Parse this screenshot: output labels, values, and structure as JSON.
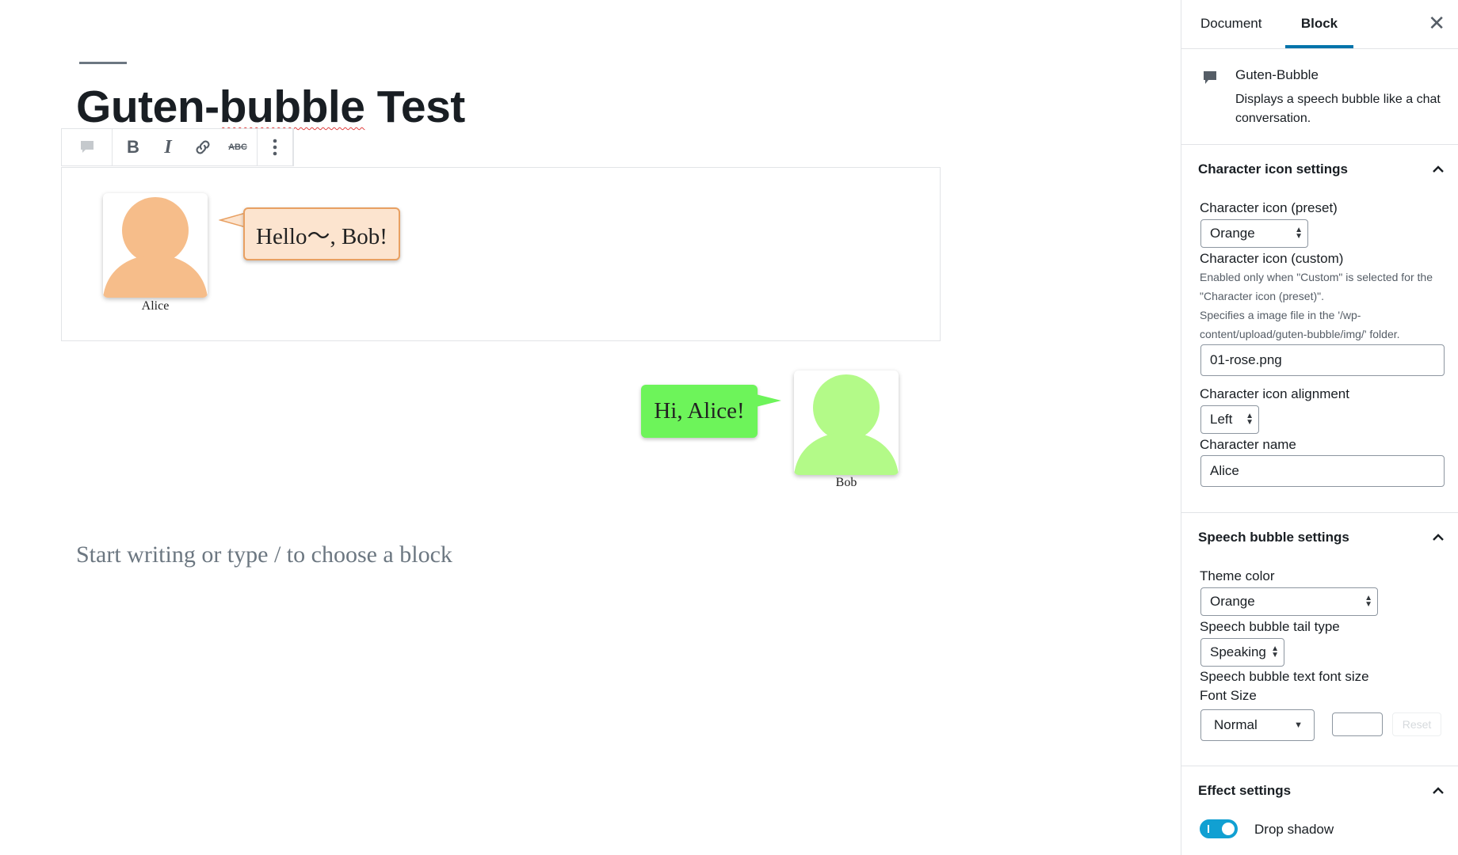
{
  "editor": {
    "post_title_part1": "Guten-",
    "post_title_part2": "bubble",
    "post_title_part3": " Test",
    "placeholder": "Start writing or type / to choose a block",
    "toolbar": {
      "block_icon": "speech-bubble-icon",
      "bold": "B",
      "italic": "I",
      "link_icon": "link-icon",
      "strikethrough": "ABC",
      "more_icon": "vertical-ellipsis-icon"
    },
    "bubbles": [
      {
        "character": "Alice",
        "text": "Hello〜, Bob!",
        "avatar_color": "#f6bd8a",
        "theme": "orange"
      },
      {
        "character": "Bob",
        "text": "Hi, Alice!",
        "avatar_color": "#b3fa88",
        "bubble_color": "#6df45a",
        "theme": "green"
      }
    ]
  },
  "sidebar": {
    "tabs": [
      "Document",
      "Block"
    ],
    "active_tab": "Block",
    "block_card": {
      "title": "Guten-Bubble",
      "description": "Displays a speech bubble like a chat conversation."
    },
    "character_panel": {
      "title": "Character icon settings",
      "preset_label": "Character icon (preset)",
      "preset_value": "Orange",
      "custom_label": "Character icon (custom)",
      "custom_help_1": "Enabled only when \"Custom\" is selected for the \"Character icon (preset)\".",
      "custom_help_2": "Specifies a image file in the '/wp-content/upload/guten-bubble/img/' folder.",
      "custom_value": "01-rose.png",
      "alignment_label": "Character icon alignment",
      "alignment_value": "Left",
      "name_label": "Character name",
      "name_value": "Alice"
    },
    "bubble_panel": {
      "title": "Speech bubble settings",
      "theme_label": "Theme color",
      "theme_value": "Orange",
      "tail_label": "Speech bubble tail type",
      "tail_value": "Speaking",
      "fontsize_label": "Speech bubble text font size",
      "fontsize_sub": "Font Size",
      "fontsize_value": "Normal",
      "custom_size_value": "",
      "reset_label": "Reset"
    },
    "effect_panel": {
      "title": "Effect settings",
      "drop_shadow_label": "Drop shadow",
      "drop_shadow_on": true
    }
  },
  "colors": {
    "accent": "#0073aa",
    "toggle": "#11a0d2",
    "orange_bubble_bg": "#fce4cf",
    "orange_bubble_border": "#e8a062"
  }
}
